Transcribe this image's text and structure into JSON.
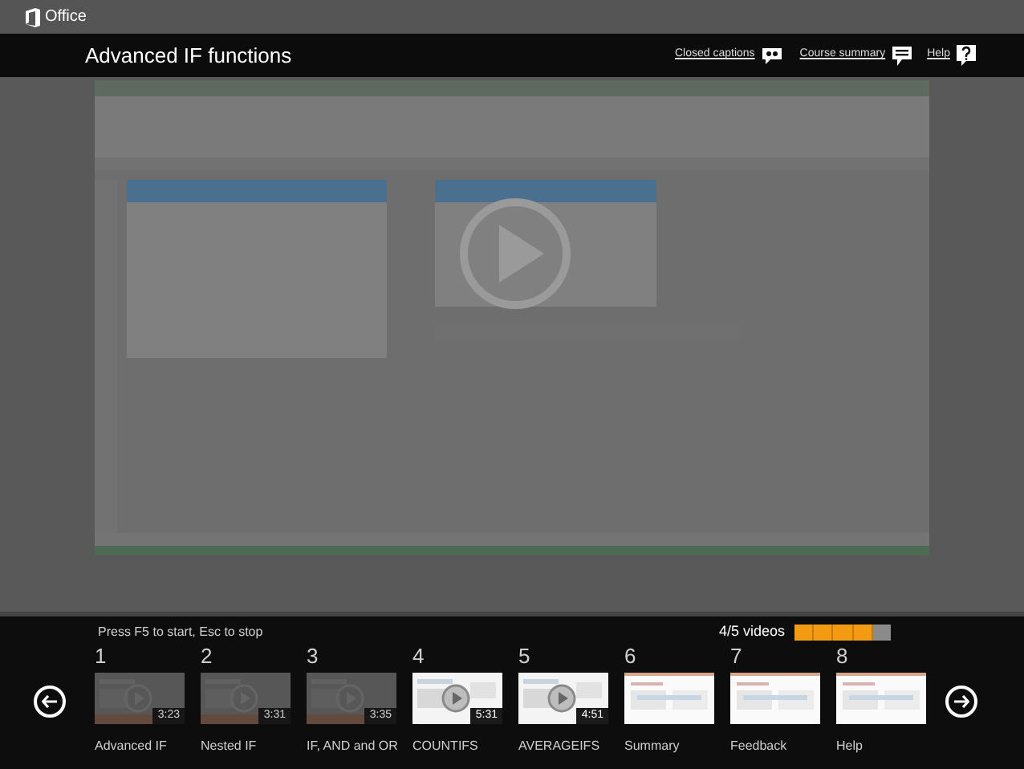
{
  "app": {
    "name": "Office"
  },
  "header": {
    "title": "Advanced IF functions",
    "links": [
      {
        "label": "Closed captions",
        "kind": "captions"
      },
      {
        "label": "Course summary",
        "kind": "summary"
      },
      {
        "label": "Help",
        "kind": "help"
      }
    ]
  },
  "footer": {
    "hint": "Press F5 to start, Esc to stop",
    "progress": {
      "label": "4/5 videos",
      "level": 0.8
    },
    "items": [
      {
        "number": "1",
        "title": "Advanced IF",
        "duration": "3:23",
        "kind": "video",
        "watched": true
      },
      {
        "number": "2",
        "title": "Nested IF",
        "duration": "3:31",
        "kind": "video",
        "watched": true
      },
      {
        "number": "3",
        "title": "IF, AND and OR",
        "duration": "3:35",
        "kind": "video",
        "watched": true
      },
      {
        "number": "4",
        "title": "COUNTIFS",
        "duration": "5:31",
        "kind": "video",
        "watched": false
      },
      {
        "number": "5",
        "title": "AVERAGEIFS",
        "duration": "4:51",
        "kind": "video",
        "watched": false
      },
      {
        "number": "6",
        "title": "Summary",
        "kind": "document",
        "watched": false
      },
      {
        "number": "7",
        "title": "Feedback",
        "kind": "document",
        "watched": false
      },
      {
        "number": "8",
        "title": "Help",
        "kind": "document",
        "watched": false
      }
    ]
  }
}
